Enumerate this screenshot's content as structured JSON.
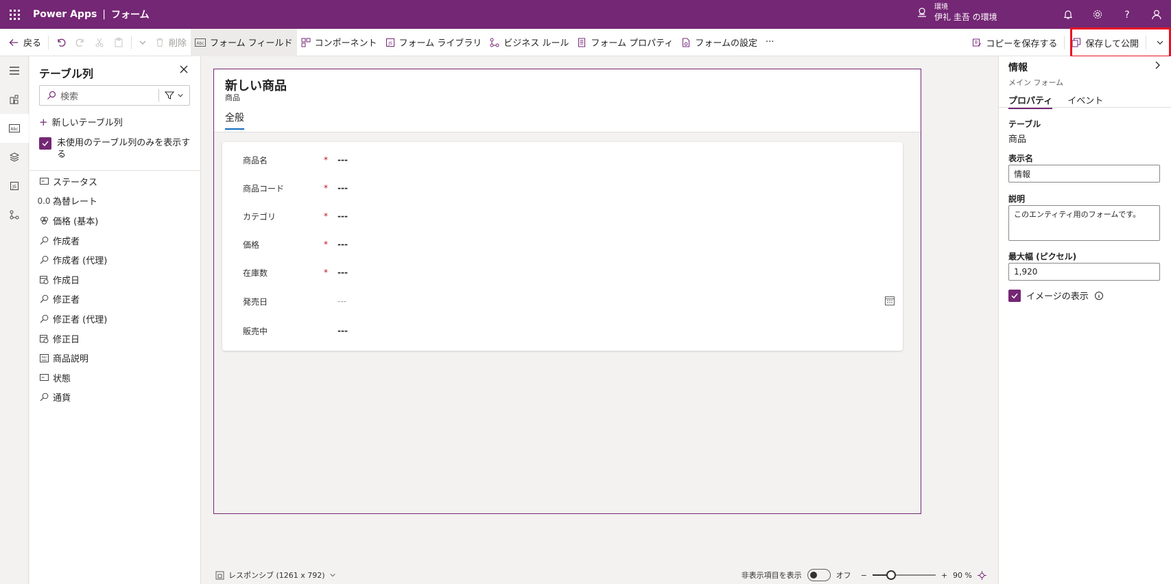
{
  "topbar": {
    "app_name": "Power Apps",
    "separator": "|",
    "section": "フォーム",
    "env_label": "環境",
    "env_name": "伊礼 圭吾 の環境"
  },
  "commandbar": {
    "back": "戻る",
    "delete": "削除",
    "form_fields": "フォーム フィールド",
    "components": "コンポーネント",
    "form_library": "フォーム ライブラリ",
    "business_rules": "ビジネス ルール",
    "form_properties": "フォーム プロパティ",
    "form_settings": "フォームの設定",
    "more": "···",
    "save_copy": "コピーを保存する",
    "save_publish": "保存して公開"
  },
  "columns_pane": {
    "title": "テーブル列",
    "search_placeholder": "検索",
    "new_column": "新しいテーブル列",
    "unused_only": "未使用のテーブル列のみを表示する",
    "items": [
      {
        "label": "ステータス",
        "icon": "option-set-icon"
      },
      {
        "label": "為替レート",
        "icon": "decimal-icon",
        "glyph": "0.0"
      },
      {
        "label": "価格 (基本)",
        "icon": "currency-icon"
      },
      {
        "label": "作成者",
        "icon": "lookup-icon"
      },
      {
        "label": "作成者 (代理)",
        "icon": "lookup-icon"
      },
      {
        "label": "作成日",
        "icon": "datetime-icon"
      },
      {
        "label": "修正者",
        "icon": "lookup-icon"
      },
      {
        "label": "修正者 (代理)",
        "icon": "lookup-icon"
      },
      {
        "label": "修正日",
        "icon": "datetime-icon"
      },
      {
        "label": "商品説明",
        "icon": "multiline-text-icon"
      },
      {
        "label": "状態",
        "icon": "option-set-icon"
      },
      {
        "label": "通貨",
        "icon": "lookup-icon"
      }
    ]
  },
  "form": {
    "title": "新しい商品",
    "subtitle": "商品",
    "tab": "全般",
    "fields": [
      {
        "label": "商品名",
        "required": "*",
        "value": "---"
      },
      {
        "label": "商品コード",
        "required": "*",
        "value": "---"
      },
      {
        "label": "カテゴリ",
        "required": "*",
        "value": "---"
      },
      {
        "label": "価格",
        "required": "*",
        "value": "---"
      },
      {
        "label": "在庫数",
        "required": "*",
        "value": "---"
      },
      {
        "label": "発売日",
        "required": "",
        "value": "---"
      },
      {
        "label": "販売中",
        "required": "",
        "value": "---"
      }
    ]
  },
  "statusbar": {
    "layout": "レスポンシブ (1261 x 792)",
    "show_hidden": "非表示項目を表示",
    "toggle_state": "オフ",
    "zoom_minus": "−",
    "zoom_plus": "+",
    "zoom": "90 %",
    "zoom_fraction": 0.3
  },
  "properties": {
    "title": "情報",
    "subtitle": "メイン フォーム",
    "tab_properties": "プロパティ",
    "tab_events": "イベント",
    "table_label": "テーブル",
    "table_value": "商品",
    "display_name_label": "表示名",
    "display_name_value": "情報",
    "description_label": "説明",
    "description_value": "このエンティティ用のフォームです。",
    "max_width_label": "最大幅 (ピクセル)",
    "max_width_value": "1,920",
    "show_image": "イメージの表示"
  },
  "colors": {
    "brand": "#742774",
    "accent_tab": "#0f6cbd",
    "required": "#c50f1f",
    "highlight": "#e81123"
  }
}
